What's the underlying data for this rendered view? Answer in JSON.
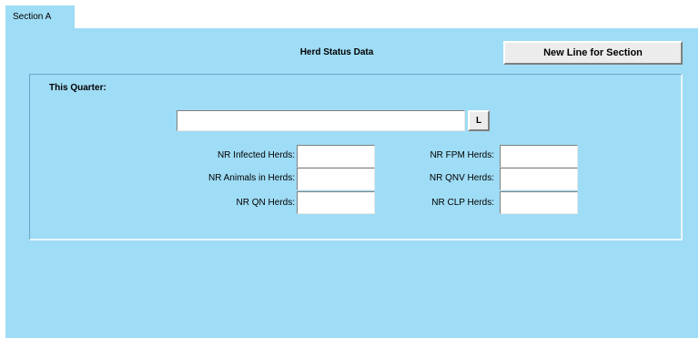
{
  "tab": {
    "label": "Section A"
  },
  "panel": {
    "title": "Herd Status Data",
    "new_line_button": "New Line for Section"
  },
  "group": {
    "label": "This Quarter:",
    "lookup_value": "",
    "lookup_button": "L"
  },
  "fields": {
    "infected_herds": {
      "label": "NR Infected Herds:",
      "value": ""
    },
    "animals_in_herds": {
      "label": "NR Animals in Herds:",
      "value": ""
    },
    "qn_herds": {
      "label": "NR QN Herds:",
      "value": ""
    },
    "fpm_herds": {
      "label": "NR FPM Herds:",
      "value": ""
    },
    "qnv_herds": {
      "label": "NR QNV Herds:",
      "value": ""
    },
    "clp_herds": {
      "label": "NR CLP Herds:",
      "value": ""
    }
  },
  "colors": {
    "panel_bg": "#9fdcf5",
    "button_bg": "#ececec"
  }
}
